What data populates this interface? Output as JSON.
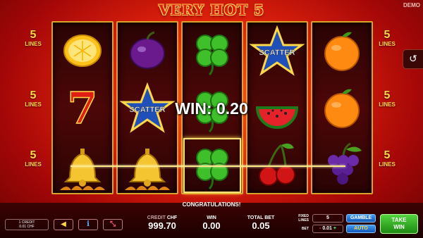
{
  "game": {
    "title": "VERY HOT 5",
    "mode_badge": "DEMO",
    "lines_badges": [
      {
        "number": "5",
        "label": "LINES"
      },
      {
        "number": "5",
        "label": "LINES"
      },
      {
        "number": "5",
        "label": "LINES"
      },
      {
        "number": "5",
        "label": "LINES"
      },
      {
        "number": "5",
        "label": "LINES"
      },
      {
        "number": "5",
        "label": "LINES"
      }
    ],
    "reels": [
      [
        "lemon",
        "seven",
        "bell"
      ],
      [
        "plum",
        "scatter-star",
        "bell"
      ],
      [
        "clover",
        "clover",
        "clover"
      ],
      [
        "scatter-star",
        "watermelon",
        "cherry"
      ],
      [
        "orange",
        "orange",
        "grapes"
      ]
    ],
    "scatter_label": "SCATTER",
    "win_message": "WIN: 0.20",
    "congrats_text": "CONGRATULATIONS!",
    "history_icon": "history-icon"
  },
  "controls": {
    "credit_line1": "1 CREDIT",
    "credit_line2": "0.01 CHF",
    "credit_label": "CREDIT",
    "currency": "CHF",
    "credit_value": "999.70",
    "win_label": "WIN",
    "win_value": "0.00",
    "total_bet_label": "TOTAL BET",
    "total_bet_value": "0.05",
    "fixed_lines_label_1": "FIXED",
    "fixed_lines_label_2": "LINES",
    "fixed_lines_value": "5",
    "bet_label": "BET",
    "bet_minus": "-",
    "bet_value": "0.01",
    "bet_plus": "+",
    "gamble_label": "GAMBLE",
    "auto_label": "AUTO",
    "take_win_line1": "TAKE",
    "take_win_line2": "WIN",
    "button_icons": [
      "sound-icon",
      "info-icon",
      "fullscreen-icon"
    ]
  },
  "colors": {
    "accent_gold": "#ffd94a",
    "take_win_green": "#2bb01c",
    "gamble_blue": "#2a7ad8"
  }
}
